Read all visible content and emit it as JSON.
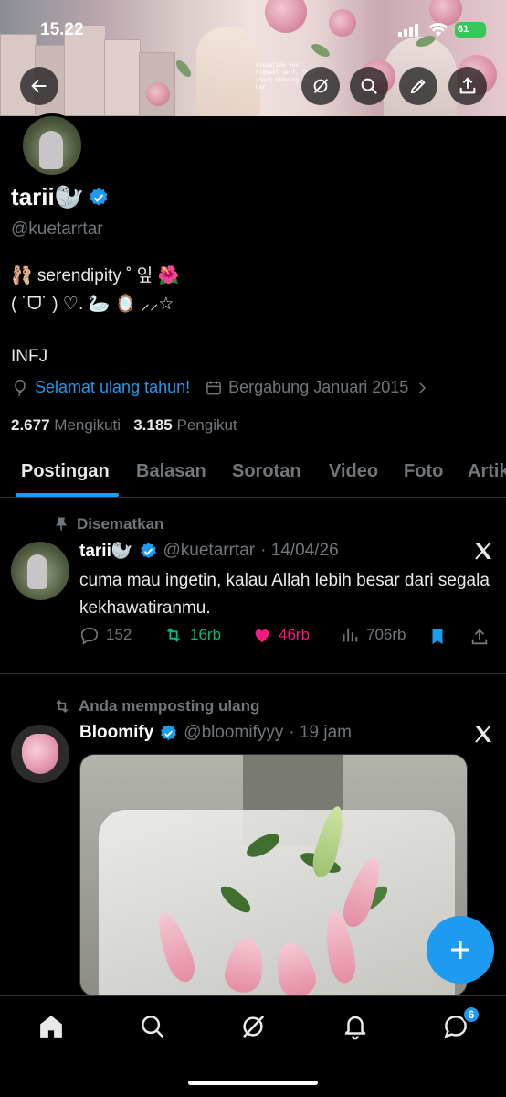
{
  "status_bar": {
    "time": "15.22",
    "battery": "61"
  },
  "banner": {
    "note_text": "Visualize your highest self, then start showing up as her"
  },
  "profile": {
    "name": "tarii🦭",
    "handle": "@kuetarrtar",
    "bio_line1": "🩰 serendipity ˚ 잎 🌺",
    "bio_line2": "( ˙ᗜ˙ ) ♡. 🦢 🪞 ⸝⸝☆",
    "bio_line3": "INFJ",
    "birthday": "Selamat ulang tahun!",
    "joined": "Bergabung Januari 2015",
    "following_count": "2.677",
    "following_label": "Mengikuti",
    "followers_count": "3.185",
    "followers_label": "Pengikut"
  },
  "tabs": [
    "Postingan",
    "Balasan",
    "Sorotan",
    "Video",
    "Foto",
    "Artikel"
  ],
  "active_tab": "Postingan",
  "posts": [
    {
      "context": "Disematkan",
      "name": "tarii🦭",
      "handle": "@kuetarrtar",
      "date": "· 14/04/26",
      "text": "cuma mau ingetin, kalau Allah lebih besar dari segala kekhawatiranmu.",
      "replies": "152",
      "reposts": "16rb",
      "likes": "46rb",
      "views": "706rb"
    },
    {
      "context": "Anda memposting ulang",
      "name": "Bloomify",
      "handle": "@bloomifyyy",
      "date": "· 19 jam"
    }
  ],
  "nav": {
    "messages_badge": "6"
  },
  "colors": {
    "accent": "#1d9bf0",
    "like": "#f91880",
    "repost": "#00ba7c",
    "verified": "#1d9bf0"
  }
}
